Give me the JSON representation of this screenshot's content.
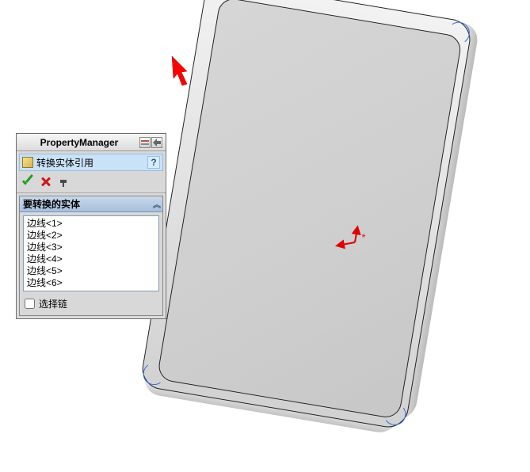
{
  "panel": {
    "title": "PropertyManager",
    "feature_name": "转换实体引用",
    "help_label": "?"
  },
  "section": {
    "header": "要转换的实体",
    "items": [
      "边线<1>",
      "边线<2>",
      "边线<3>",
      "边线<4>",
      "边线<5>",
      "边线<6>"
    ]
  },
  "checkbox": {
    "label": "选择链",
    "checked": false
  }
}
